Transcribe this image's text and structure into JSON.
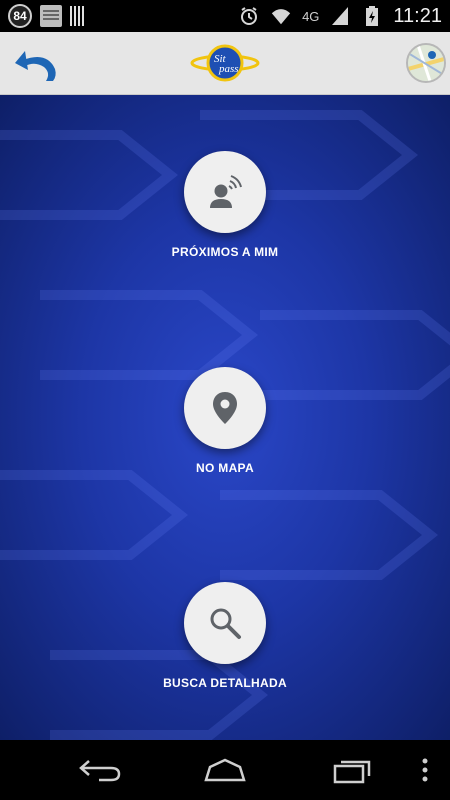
{
  "status_bar": {
    "notification_count": "84",
    "network_label": "4G",
    "time": "11:21",
    "icons": [
      "bible-app-icon",
      "barcode-icon",
      "alarm-icon",
      "wifi-icon",
      "signal-icon",
      "battery-charging-icon"
    ]
  },
  "header": {
    "logo_text_1": "Sit",
    "logo_text_2": "pass",
    "icons": [
      "undo-icon",
      "map-thumbnail"
    ]
  },
  "options": [
    {
      "label": "PRÓXIMOS A MIM",
      "icon": "person-signal-icon"
    },
    {
      "label": "NO MAPA",
      "icon": "map-pin-icon"
    },
    {
      "label": "BUSCA DETALHADA",
      "icon": "search-icon"
    }
  ],
  "nav_bar": {
    "icons": [
      "back-icon",
      "home-icon",
      "recent-apps-icon",
      "menu-icon"
    ]
  },
  "colors": {
    "header_bg": "#e6e6e6",
    "main_bg": "#1d36a6",
    "accent_blue": "#1e66b5",
    "logo_yellow": "#f1c40f",
    "icon_gray": "#666666"
  }
}
